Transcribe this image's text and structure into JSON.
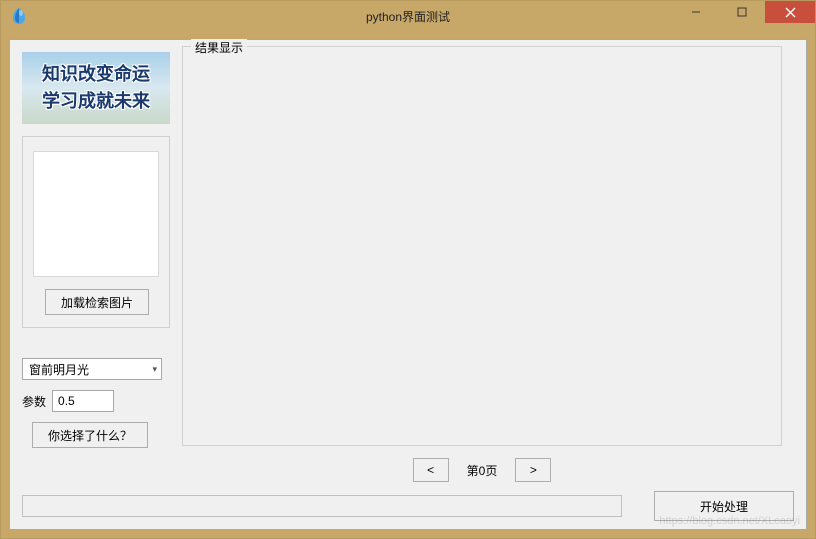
{
  "window": {
    "title": "python界面测试"
  },
  "banner": {
    "line1": "知识改变命运",
    "line2": "学习成就未来"
  },
  "sidebar": {
    "load_button": "加载检索图片",
    "dropdown_selected": "窗前明月光",
    "param_label": "参数",
    "param_value": "0.5",
    "choice_button": "你选择了什么？"
  },
  "result": {
    "group_label": "结果显示"
  },
  "pager": {
    "prev": "<",
    "page_label": "第0页",
    "next": ">"
  },
  "actions": {
    "start": "开始处理"
  },
  "watermark": "https://blog.csdn.net/XLcaoyi"
}
